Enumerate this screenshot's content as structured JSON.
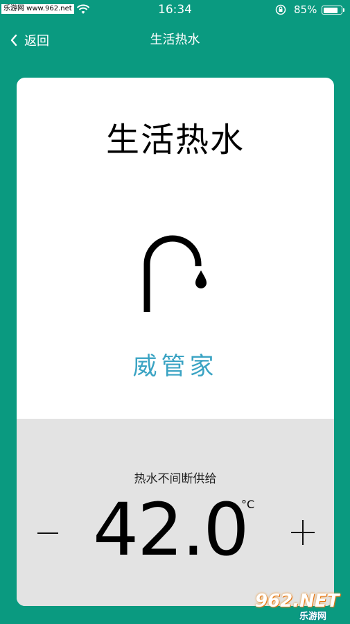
{
  "status_bar": {
    "watermark": "乐游网 www.962.net",
    "time": "16:34",
    "battery_percent": "85%",
    "battery_level": 0.85
  },
  "nav": {
    "back_label": "返回",
    "title": "生活热水"
  },
  "card": {
    "title": "生活热水",
    "brand": "威管家",
    "subtitle": "热水不间断供给",
    "temperature": "42.0",
    "unit": "°C",
    "minus_label": "−",
    "plus_label": "+"
  },
  "watermark_br": {
    "logo": "962.NET",
    "sub": "乐游网"
  },
  "colors": {
    "background": "#0a9a80",
    "brand_text": "#3aa3c3",
    "panel": "#e3e3e3"
  }
}
